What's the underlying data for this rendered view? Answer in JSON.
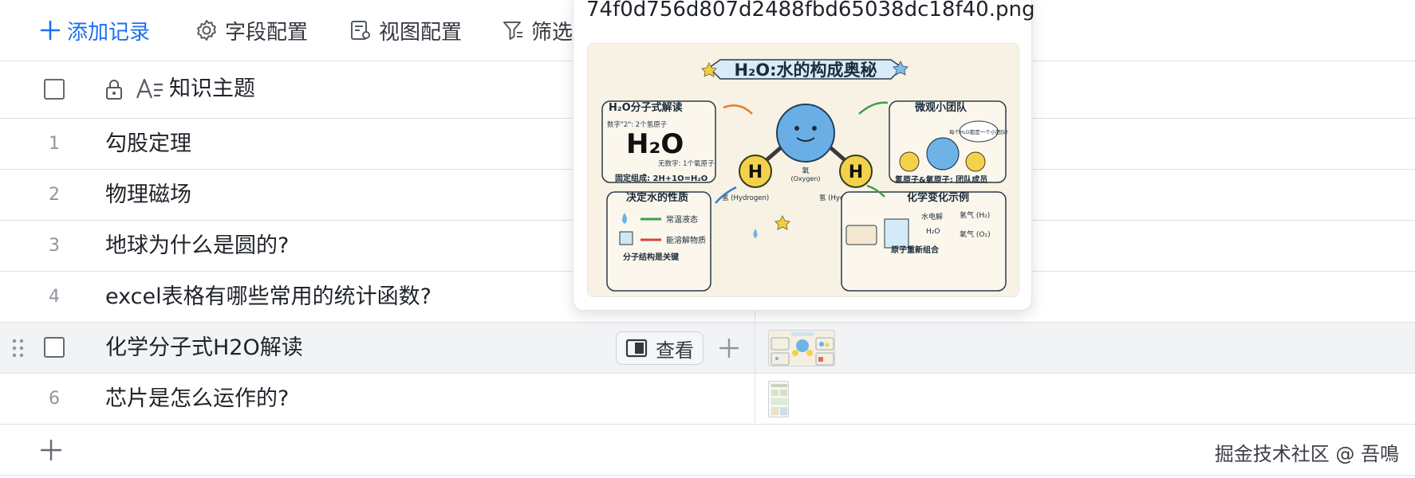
{
  "toolbar": {
    "add_record": "添加记录",
    "field_config": "字段配置",
    "view_config": "视图配置",
    "filter": "筛选"
  },
  "table": {
    "header_title": "知识主题",
    "rows": [
      {
        "num": "1",
        "title": "勾股定理"
      },
      {
        "num": "2",
        "title": "物理磁场"
      },
      {
        "num": "3",
        "title": "地球为什么是圆的?"
      },
      {
        "num": "4",
        "title": "excel表格有哪些常用的统计函数?"
      },
      {
        "num": "",
        "title": "化学分子式H2O解读"
      },
      {
        "num": "6",
        "title": "芯片是怎么运作的?"
      }
    ],
    "view_button": "查看"
  },
  "popover": {
    "filename": "74f0d756d807d2488fbd65038dc18f40.png",
    "image": {
      "title": "H₂O:水的构成奥秘",
      "panel_tl_title": "H₂O分子式解读",
      "panel_tl_note1": "数字\"2\": 2个氢原子",
      "panel_tl_formula": "H₂O",
      "panel_tl_note2": "无数字: 1个氧原子",
      "panel_tl_footer": "固定组成: 2H+1O=H₂O",
      "panel_tr_title": "微观小团队",
      "panel_tr_bubble": "每个H₂O都是一个小团队!",
      "panel_tr_footer": "氢原子&氧原子: 团队成员",
      "center_o": "氧",
      "center_o_en": "(Oxygen)",
      "h_label_left": "氢 (Hydrogen)",
      "h_label_right": "氢 (Hydrogen)",
      "h_letter": "H",
      "panel_bl_title": "决定水的性质",
      "panel_bl_item1": "常温液态",
      "panel_bl_item2": "能溶解物质",
      "panel_bl_footer": "分子结构是关键",
      "panel_br_title": "化学变化示例",
      "panel_br_step": "水电解",
      "panel_br_reactant": "H₂O",
      "panel_br_out1": "氢气 (H₂)",
      "panel_br_out2": "氧气 (O₂)",
      "panel_br_footer": "原子重新组合"
    }
  },
  "watermark": "掘金技术社区 @ 吾鳴",
  "colors": {
    "primary": "#1d6ff2",
    "border": "#dee0e3",
    "hover_row": "#f2f3f5"
  }
}
